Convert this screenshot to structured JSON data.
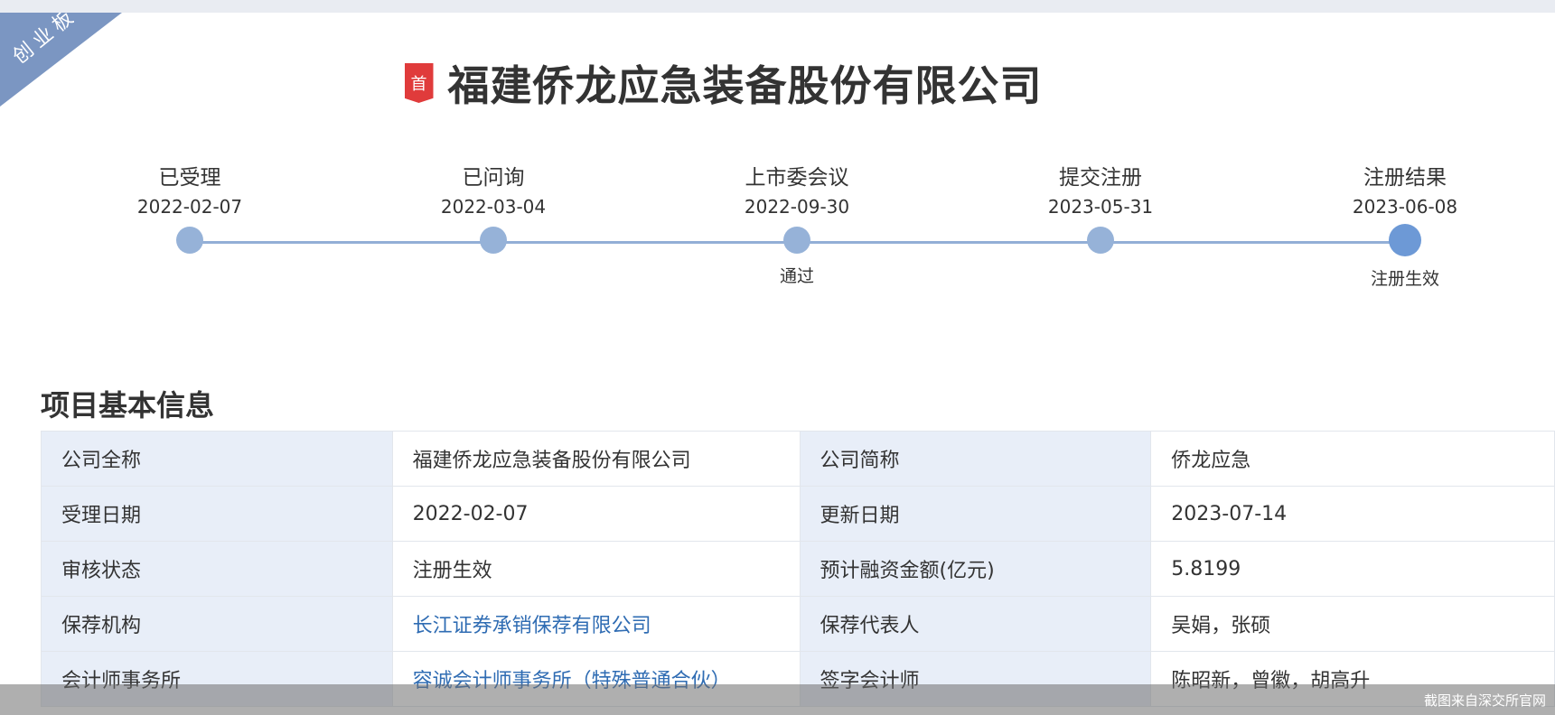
{
  "board_ribbon": "创业板",
  "header": {
    "first_badge": "首",
    "company_name": "福建侨龙应急装备股份有限公司"
  },
  "timeline": [
    {
      "label": "已受理",
      "date": "2022-02-07",
      "status": ""
    },
    {
      "label": "已问询",
      "date": "2022-03-04",
      "status": ""
    },
    {
      "label": "上市委会议",
      "date": "2022-09-30",
      "status": "通过"
    },
    {
      "label": "提交注册",
      "date": "2023-05-31",
      "status": ""
    },
    {
      "label": "注册结果",
      "date": "2023-06-08",
      "status": "注册生效"
    }
  ],
  "section": {
    "title": "项目基本信息"
  },
  "table": {
    "rows": [
      {
        "k1": "公司全称",
        "v1": "福建侨龙应急装备股份有限公司",
        "k2": "公司简称",
        "v2": "侨龙应急"
      },
      {
        "k1": "受理日期",
        "v1": "2022-02-07",
        "k2": "更新日期",
        "v2": "2023-07-14"
      },
      {
        "k1": "审核状态",
        "v1": "注册生效",
        "k2": "预计融资金额(亿元)",
        "v2": "5.8199"
      },
      {
        "k1": "保荐机构",
        "v1": "长江证券承销保荐有限公司",
        "k2": "保荐代表人",
        "v2": "吴娟，张硕"
      },
      {
        "k1": "会计师事务所",
        "v1": "容诚会计师事务所（特殊普通合伙）",
        "k2": "签字会计师",
        "v2": "陈昭新，曾徽，胡高升"
      }
    ]
  },
  "watermark": "截图来自深交所官网"
}
